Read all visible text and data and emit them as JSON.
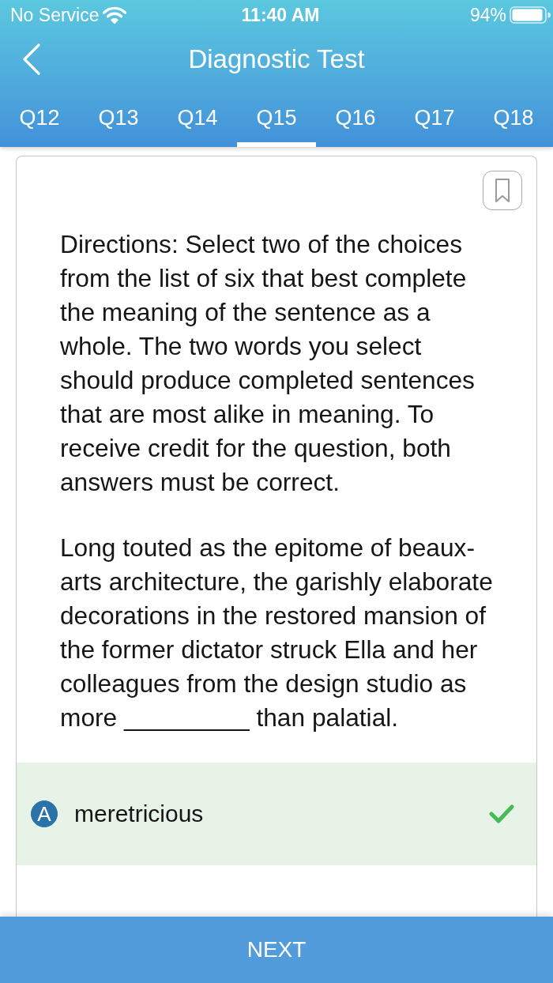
{
  "status_bar": {
    "carrier": "No Service",
    "time": "11:40 AM",
    "battery": "94%"
  },
  "header": {
    "title": "Diagnostic Test"
  },
  "tabs": [
    {
      "label": "Q12",
      "selected": false
    },
    {
      "label": "Q13",
      "selected": false
    },
    {
      "label": "Q14",
      "selected": false
    },
    {
      "label": "Q15",
      "selected": true
    },
    {
      "label": "Q16",
      "selected": false
    },
    {
      "label": "Q17",
      "selected": false
    },
    {
      "label": "Q18",
      "selected": false
    }
  ],
  "question": {
    "bookmarked": false,
    "paragraphs": [
      "Directions: Select two of the choices from the list of six that best complete the meaning of the sentence as a whole. The two words you select should produce completed sentences that are most alike in meaning. To receive credit for the question, both answers must be correct.",
      "Long touted as the epitome of beaux-arts architecture, the garishly elaborate decorations in the restored mansion of the former dictator struck Ella and her colleagues from the design studio as more _________ than palatial."
    ]
  },
  "options": [
    {
      "letter": "A",
      "text": "meretricious",
      "selected": true
    }
  ],
  "next_button": {
    "label": "NEXT"
  }
}
